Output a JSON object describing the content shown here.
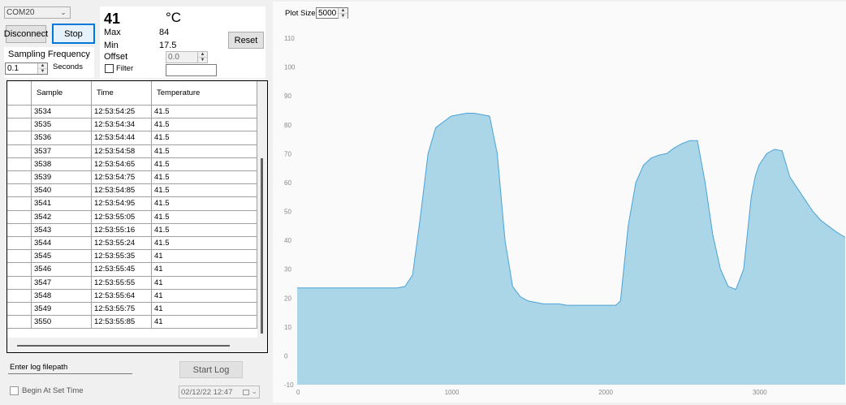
{
  "port": {
    "selected": "COM20"
  },
  "buttons": {
    "disconnect": "Disconnect",
    "stop": "Stop",
    "reset": "Reset",
    "start_log": "Start Log"
  },
  "sampling": {
    "label": "Sampling Frequency",
    "value": "0.1",
    "unit": "Seconds"
  },
  "reading": {
    "current": "41",
    "unit": "°C",
    "max_label": "Max",
    "max_value": "84",
    "min_label": "Min",
    "min_value": "17.5",
    "offset_label": "Offset",
    "offset_value": "0.0",
    "filter_label": "Filter"
  },
  "table": {
    "columns": [
      "Sample",
      "Time",
      "Temperature"
    ],
    "rows": [
      [
        "3534",
        "12:53:54:25",
        "41.5"
      ],
      [
        "3535",
        "12:53:54:34",
        "41.5"
      ],
      [
        "3536",
        "12:53:54:44",
        "41.5"
      ],
      [
        "3537",
        "12:53:54:58",
        "41.5"
      ],
      [
        "3538",
        "12:53:54:65",
        "41.5"
      ],
      [
        "3539",
        "12:53:54:75",
        "41.5"
      ],
      [
        "3540",
        "12:53:54:85",
        "41.5"
      ],
      [
        "3541",
        "12:53:54:95",
        "41.5"
      ],
      [
        "3542",
        "12:53:55:05",
        "41.5"
      ],
      [
        "3543",
        "12:53:55:16",
        "41.5"
      ],
      [
        "3544",
        "12:53:55:24",
        "41.5"
      ],
      [
        "3545",
        "12:53:55:35",
        "41"
      ],
      [
        "3546",
        "12:53:55:45",
        "41"
      ],
      [
        "3547",
        "12:53:55:55",
        "41"
      ],
      [
        "3548",
        "12:53:55:64",
        "41"
      ],
      [
        "3549",
        "12:53:55:75",
        "41"
      ],
      [
        "3550",
        "12:53:55:85",
        "41"
      ]
    ]
  },
  "log": {
    "filepath_label": "Enter log filepath",
    "begin_label": "Begin At Set Time",
    "datetime": "02/12/22 12:47"
  },
  "plot": {
    "size_label": "Plot Size",
    "size_value": "5000"
  },
  "chart_data": {
    "type": "area",
    "xlim": [
      0,
      3560
    ],
    "ylim": [
      -10,
      115
    ],
    "x_ticks": [
      0,
      1000,
      2000,
      3000
    ],
    "y_ticks": [
      -10,
      0,
      10,
      20,
      30,
      40,
      50,
      60,
      70,
      80,
      90,
      100,
      110
    ],
    "grid": false,
    "fill_color": "#aad6e8",
    "line_color": "#4aa3d6",
    "series": [
      {
        "x": [
          0,
          100,
          200,
          300,
          400,
          560,
          600,
          650,
          700,
          750,
          800,
          850,
          900,
          1000,
          1050,
          1100,
          1150,
          1200,
          1250,
          1300,
          1350,
          1400,
          1450,
          1500,
          1550,
          1600,
          1650,
          1700,
          1750,
          1800,
          1850,
          1900,
          1950,
          2000,
          2050,
          2070,
          2100,
          2150,
          2200,
          2250,
          2300,
          2350,
          2400,
          2450,
          2500,
          2550,
          2600,
          2650,
          2700,
          2750,
          2800,
          2850,
          2900,
          2950,
          2975,
          3000,
          3050,
          3100,
          3150,
          3200,
          3250,
          3300,
          3350,
          3400,
          3450,
          3500,
          3560
        ],
        "y": [
          23.5,
          23.5,
          23.5,
          23.5,
          23.5,
          23.5,
          23.5,
          23.5,
          24,
          28,
          48,
          70,
          79,
          83,
          83.5,
          84,
          84,
          83.5,
          83,
          70,
          40,
          24,
          20.5,
          19,
          18.5,
          18,
          18,
          18,
          17.5,
          17.5,
          17.5,
          17.5,
          17.5,
          17.5,
          17.5,
          17.5,
          19,
          45,
          60,
          66,
          68.5,
          69.5,
          70,
          72,
          73.5,
          74.5,
          74.5,
          60,
          42,
          30,
          24,
          23,
          30,
          55,
          62,
          66,
          70,
          71.5,
          71,
          62,
          58,
          54,
          50,
          47,
          45,
          43,
          41
        ]
      }
    ]
  }
}
